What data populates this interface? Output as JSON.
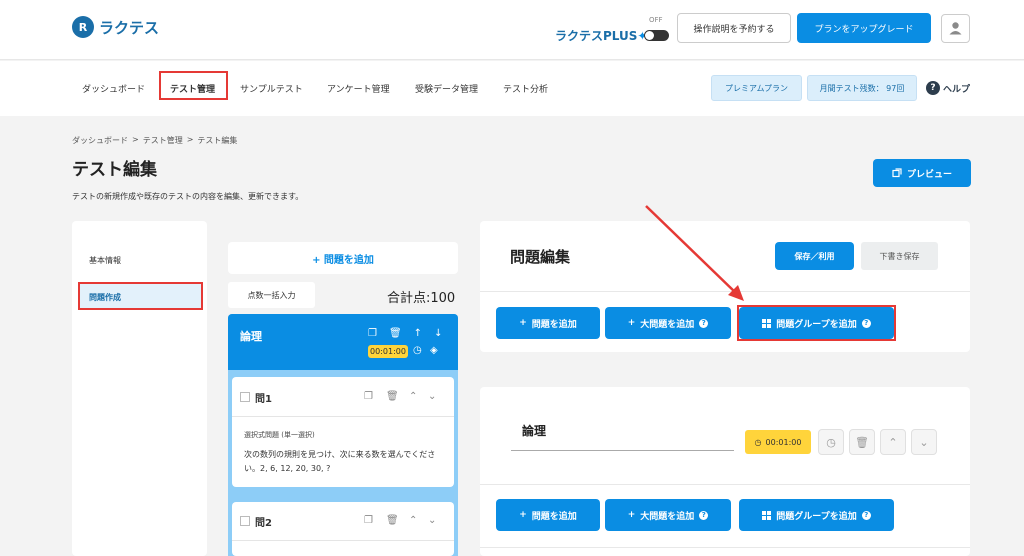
{
  "header": {
    "logo_text": "ラクテス",
    "plus_label": "ラクテスPLUS",
    "plus_toggle_state": "OFF",
    "reserve_button": "操作説明を予約する",
    "upgrade_button": "プランをアップグレード"
  },
  "nav": {
    "items": [
      "ダッシュボード",
      "テスト管理",
      "サンプルテスト",
      "アンケート管理",
      "受験データ管理",
      "テスト分析"
    ],
    "plan_badge": "プレミアムプラン",
    "monthly_badge": "月間テスト残数： 97回",
    "help": "ヘルプ"
  },
  "breadcrumb": {
    "items": [
      "ダッシュボード",
      "テスト管理",
      "テスト編集"
    ],
    "separator": ">"
  },
  "page": {
    "title": "テスト編集",
    "description": "テストの新規作成や既存のテストの内容を編集、更新できます。",
    "preview_button": "プレビュー"
  },
  "sidebar": {
    "items": [
      "基本情報",
      "問題作成"
    ]
  },
  "question_list": {
    "add_question": "+ 問題を追加",
    "bulk_score": "点数一括入力",
    "total_score": "合計点:100",
    "group_title": "論理",
    "group_timer": "00:01:00",
    "questions": [
      {
        "label": "問1",
        "type": "選択式問題 (単一選択)",
        "text": "次の数列の規則を見つけ、次に来る数を選んでください。2, 6, 12, 20, 30, ?"
      },
      {
        "label": "問2"
      }
    ]
  },
  "editor": {
    "title": "問題編集",
    "save_button": "保存／利用",
    "draft_button": "下書き保存",
    "add_question": "問題を追加",
    "add_big_question": "大問題を追加",
    "add_group": "問題グループを追加",
    "group_name": "論理",
    "group_timer": "00:01:00"
  },
  "colors": {
    "primary": "#0a8de3",
    "brand": "#1a6ea8",
    "highlight": "#e53935",
    "timer": "#ffd43b"
  }
}
